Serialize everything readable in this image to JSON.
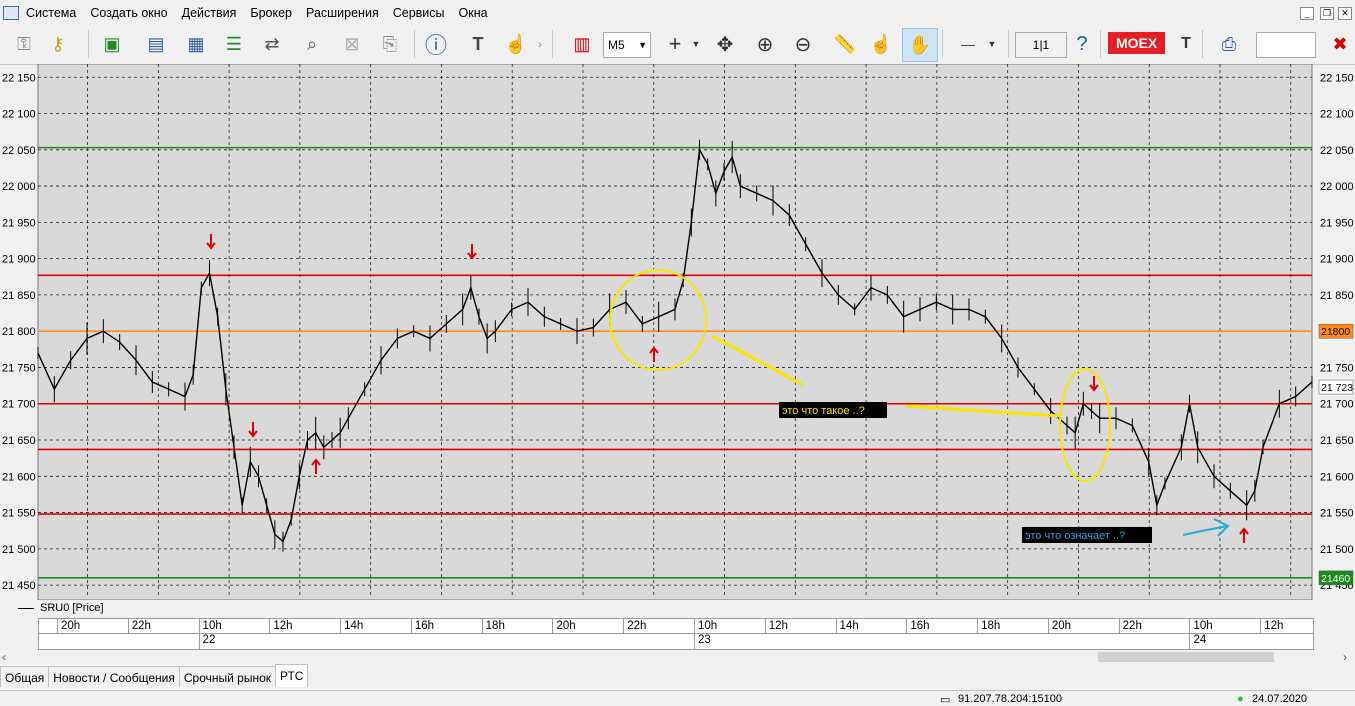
{
  "menu": [
    "Система",
    "Создать окно",
    "Действия",
    "Брокер",
    "Расширения",
    "Сервисы",
    "Окна"
  ],
  "toolbar": {
    "timeframe": "M5",
    "page_indicator": "1|1",
    "exchange_label": "MOEX",
    "tf_partial": "T"
  },
  "chart_data": {
    "type": "line",
    "title": "",
    "series_name": "SRU0 [Price]",
    "ylim": [
      21435,
      22160
    ],
    "y_ticks": [
      22150,
      22100,
      22050,
      22000,
      21950,
      21900,
      21850,
      21800,
      21750,
      21700,
      21650,
      21600,
      21550,
      21500,
      21450
    ],
    "y_tick_labels": [
      "22 150",
      "22 100",
      "22 050",
      "22 000",
      "21 950",
      "21 900",
      "21 850",
      "21 800",
      "21 750",
      "21 700",
      "21 650",
      "21 600",
      "21 550",
      "21 500",
      "21 450"
    ],
    "x_labels": [
      {
        "label": "20h"
      },
      {
        "label": "22h"
      },
      {
        "label": "10h"
      },
      {
        "label": "12h"
      },
      {
        "label": "14h"
      },
      {
        "label": "16h"
      },
      {
        "label": "18h"
      },
      {
        "label": "20h"
      },
      {
        "label": "22h"
      },
      {
        "label": "10h"
      },
      {
        "label": "12h"
      },
      {
        "label": "14h"
      },
      {
        "label": "16h"
      },
      {
        "label": "18h"
      },
      {
        "label": "20h"
      },
      {
        "label": "22h"
      },
      {
        "label": "10h"
      },
      {
        "label": "12h"
      }
    ],
    "day_labels": [
      "22",
      "23",
      "24"
    ],
    "price_path": [
      [
        0,
        21770
      ],
      [
        2,
        21720
      ],
      [
        4,
        21760
      ],
      [
        6,
        21790
      ],
      [
        8,
        21800
      ],
      [
        10,
        21785
      ],
      [
        12,
        21760
      ],
      [
        14,
        21730
      ],
      [
        16,
        21720
      ],
      [
        18,
        21710
      ],
      [
        19,
        21740
      ],
      [
        20,
        21860
      ],
      [
        21,
        21880
      ],
      [
        22,
        21820
      ],
      [
        23,
        21720
      ],
      [
        24,
        21640
      ],
      [
        25,
        21560
      ],
      [
        26,
        21620
      ],
      [
        27,
        21600
      ],
      [
        28,
        21560
      ],
      [
        29,
        21520
      ],
      [
        30,
        21510
      ],
      [
        31,
        21540
      ],
      [
        32,
        21600
      ],
      [
        33,
        21650
      ],
      [
        34,
        21660
      ],
      [
        35,
        21640
      ],
      [
        36,
        21650
      ],
      [
        37,
        21660
      ],
      [
        38,
        21680
      ],
      [
        40,
        21720
      ],
      [
        42,
        21760
      ],
      [
        44,
        21790
      ],
      [
        46,
        21800
      ],
      [
        48,
        21790
      ],
      [
        50,
        21810
      ],
      [
        52,
        21830
      ],
      [
        53,
        21860
      ],
      [
        54,
        21820
      ],
      [
        55,
        21790
      ],
      [
        56,
        21800
      ],
      [
        58,
        21830
      ],
      [
        60,
        21840
      ],
      [
        62,
        21820
      ],
      [
        64,
        21810
      ],
      [
        66,
        21800
      ],
      [
        68,
        21805
      ],
      [
        70,
        21830
      ],
      [
        72,
        21840
      ],
      [
        74,
        21810
      ],
      [
        76,
        21820
      ],
      [
        78,
        21830
      ],
      [
        79,
        21870
      ],
      [
        80,
        21950
      ],
      [
        81,
        22050
      ],
      [
        82,
        22030
      ],
      [
        83,
        21990
      ],
      [
        84,
        22020
      ],
      [
        85,
        22040
      ],
      [
        86,
        22000
      ],
      [
        88,
        21990
      ],
      [
        90,
        21980
      ],
      [
        92,
        21960
      ],
      [
        94,
        21920
      ],
      [
        96,
        21880
      ],
      [
        98,
        21850
      ],
      [
        100,
        21830
      ],
      [
        102,
        21860
      ],
      [
        104,
        21850
      ],
      [
        106,
        21820
      ],
      [
        108,
        21830
      ],
      [
        110,
        21840
      ],
      [
        112,
        21830
      ],
      [
        114,
        21830
      ],
      [
        116,
        21820
      ],
      [
        118,
        21790
      ],
      [
        120,
        21750
      ],
      [
        122,
        21720
      ],
      [
        124,
        21690
      ],
      [
        126,
        21670
      ],
      [
        127,
        21660
      ],
      [
        128,
        21700
      ],
      [
        129,
        21690
      ],
      [
        130,
        21680
      ],
      [
        132,
        21680
      ],
      [
        134,
        21670
      ],
      [
        136,
        21620
      ],
      [
        137,
        21560
      ],
      [
        138,
        21590
      ],
      [
        140,
        21640
      ],
      [
        141,
        21700
      ],
      [
        142,
        21640
      ],
      [
        144,
        21600
      ],
      [
        146,
        21580
      ],
      [
        148,
        21560
      ],
      [
        149,
        21580
      ],
      [
        150,
        21640
      ],
      [
        152,
        21700
      ],
      [
        154,
        21710
      ],
      [
        156,
        21730
      ]
    ],
    "x_range": [
      0,
      156
    ],
    "horizontal_lines": [
      {
        "value": 22053,
        "color": "#1a8a1a"
      },
      {
        "value": 21877,
        "color": "#e00000"
      },
      {
        "value": 21800,
        "color": "#ff8c1a"
      },
      {
        "value": 21700,
        "color": "#e00000"
      },
      {
        "value": 21637,
        "color": "#e00000"
      },
      {
        "value": 21548,
        "color": "#e00000"
      },
      {
        "value": 21460,
        "color": "#1a8a1a"
      }
    ],
    "tags": [
      {
        "text": "21800",
        "value": 21800,
        "bg": "#ff8c1a",
        "fg": "#000"
      },
      {
        "text": "21 723",
        "value": 21723,
        "bg": "#ffffff",
        "fg": "#000"
      },
      {
        "text": "21460",
        "value": 21460,
        "bg": "#1a8a1a",
        "fg": "#fff"
      }
    ],
    "annotations": [
      {
        "text": "это что такое ..?",
        "color": "#ffe400"
      },
      {
        "text": "это что означает ..?",
        "color": "#29a8e0"
      }
    ]
  },
  "tabs": [
    "Общая",
    "Новости / Сообщения",
    "Срочный рынок",
    "РТС"
  ],
  "status": {
    "server": "91.207.78.204:15100",
    "date": "24.07.2020"
  },
  "colors": {
    "chart_bg": "#d9d9d9",
    "grid": "#222222",
    "red_line": "#e00000",
    "orange_line": "#ff8c1a",
    "green_line": "#1a8a1a"
  }
}
